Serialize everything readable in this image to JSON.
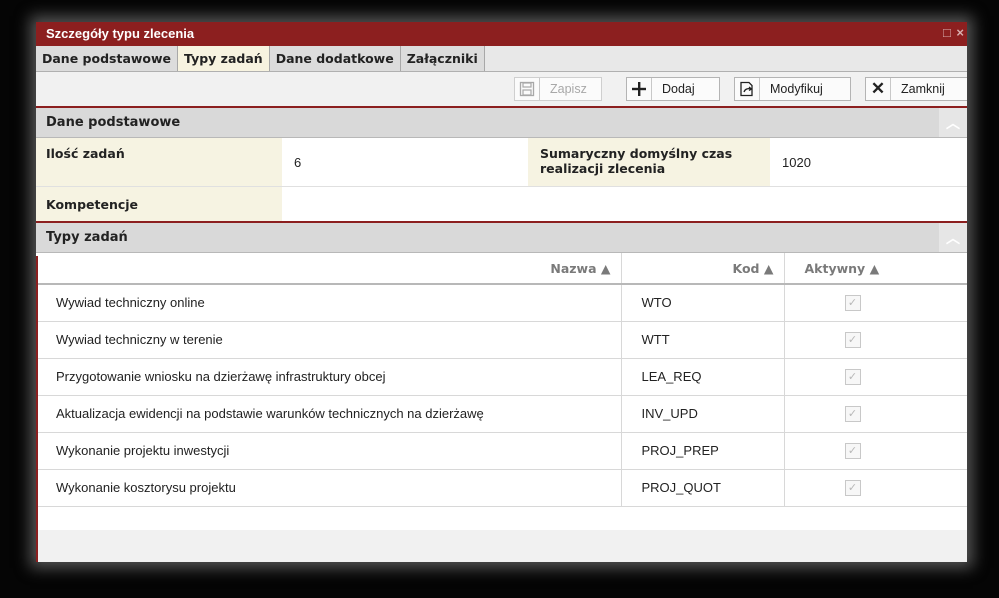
{
  "window": {
    "title": "Szczegóły typu zlecenia",
    "controls": "□ ×"
  },
  "tabs": [
    {
      "label": "Dane podstawowe",
      "active": false
    },
    {
      "label": "Typy zadań",
      "active": true
    },
    {
      "label": "Dane dodatkowe",
      "active": false
    },
    {
      "label": "Załączniki",
      "active": false
    }
  ],
  "toolbar": {
    "save_label": "Zapisz",
    "add_label": "Dodaj",
    "modify_label": "Modyfikuj",
    "close_label": "Zamknij"
  },
  "basic_section": {
    "header": "Dane podstawowe",
    "task_count_label": "Ilość zadań",
    "task_count_value": "6",
    "default_time_label": "Sumaryczny domyślny czas realizacji zlecenia",
    "default_time_value": "1020",
    "competences_label": "Kompetencje",
    "competences_value": ""
  },
  "tasks_section": {
    "header": "Typy zadań",
    "columns": {
      "name": "Nazwa",
      "code": "Kod",
      "active": "Aktywny"
    },
    "rows": [
      {
        "name": "Wywiad techniczny online",
        "code": "WTO",
        "active": true
      },
      {
        "name": "Wywiad techniczny w terenie",
        "code": "WTT",
        "active": true
      },
      {
        "name": "Przygotowanie wniosku na dzierżawę infrastruktury obcej",
        "code": "LEA_REQ",
        "active": true
      },
      {
        "name": "Aktualizacja ewidencji na podstawie warunków technicznych na dzierżawę",
        "code": "INV_UPD",
        "active": true
      },
      {
        "name": "Wykonanie projektu inwestycji",
        "code": "PROJ_PREP",
        "active": true
      },
      {
        "name": "Wykonanie kosztorysu projektu",
        "code": "PROJ_QUOT",
        "active": true
      }
    ]
  },
  "colors": {
    "accent": "#8c1f1f",
    "label_bg": "#f6f3e2"
  }
}
